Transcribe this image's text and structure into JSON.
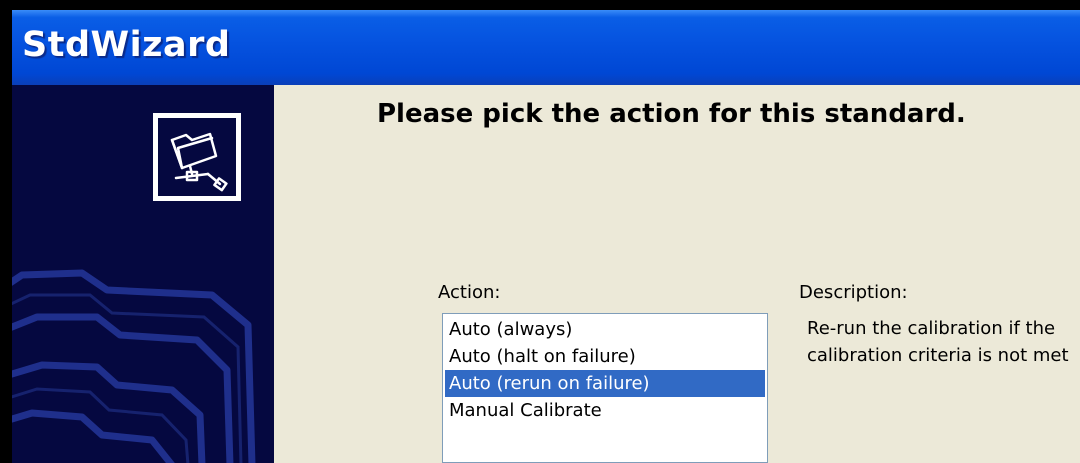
{
  "window": {
    "title": "StdWizard"
  },
  "sidebar": {
    "icon": "folder-network-icon"
  },
  "main": {
    "heading": "Please pick the action for this standard.",
    "action_label": "Action:",
    "description_label": "Description:",
    "actions": [
      {
        "label": "Auto (always)",
        "selected": false
      },
      {
        "label": "Auto (halt on failure)",
        "selected": false
      },
      {
        "label": "Auto (rerun on failure)",
        "selected": true
      },
      {
        "label": "Manual Calibrate",
        "selected": false
      }
    ],
    "description_lines": [
      "Re-run the calibration if the",
      "calibration criteria is not met"
    ]
  },
  "colors": {
    "titlebar": "#0552df",
    "sidebar": "#050840",
    "selection": "#316ac5",
    "window_bg": "#ece9d8"
  }
}
